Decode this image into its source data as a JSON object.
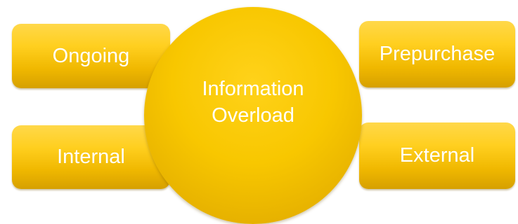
{
  "diagram": {
    "center": {
      "line1": "Information",
      "line2": "Overload"
    },
    "nodes": {
      "top_left": "Ongoing",
      "bottom_left": "Internal",
      "top_right": "Prepurchase",
      "bottom_right": "External"
    }
  },
  "colors": {
    "box_top": "#ffd84a",
    "box_bottom": "#d6a000",
    "circle_center": "#ffd21a",
    "circle_edge": "#cf9a00",
    "text": "#ffffff"
  }
}
